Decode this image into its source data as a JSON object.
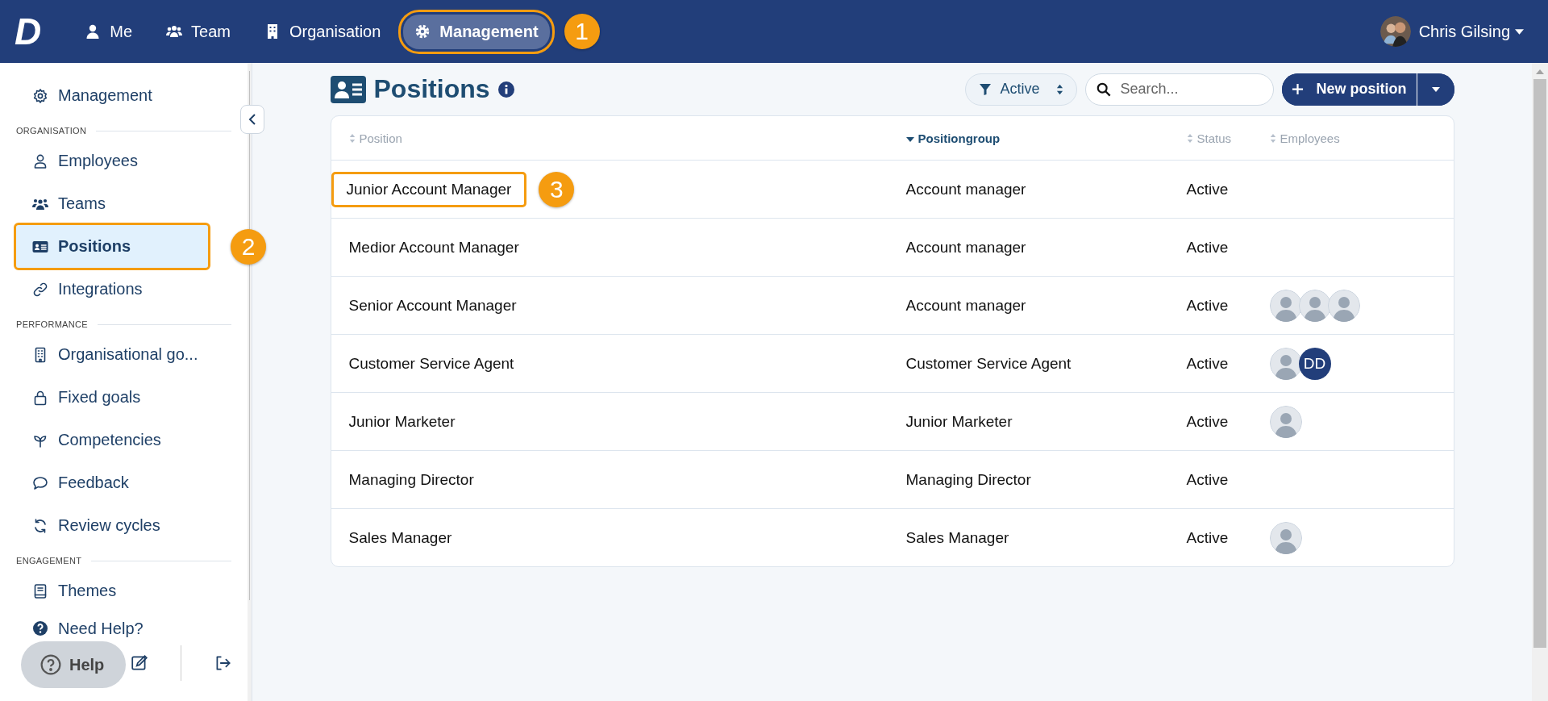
{
  "topbar": {
    "logo": "D",
    "nav": [
      {
        "label": "Me",
        "selected": false
      },
      {
        "label": "Team",
        "selected": false
      },
      {
        "label": "Organisation",
        "selected": false
      },
      {
        "label": "Management",
        "selected": true,
        "callout": "1"
      }
    ],
    "user": {
      "name": "Chris Gilsing"
    }
  },
  "sidebar": {
    "sections": [
      {
        "items": [
          {
            "label": "Management",
            "selected": false
          }
        ]
      },
      {
        "heading": "ORGANISATION",
        "items": [
          {
            "label": "Employees",
            "selected": false
          },
          {
            "label": "Teams",
            "selected": false
          },
          {
            "label": "Positions",
            "selected": true,
            "callout": "2"
          },
          {
            "label": "Integrations",
            "selected": false
          }
        ]
      },
      {
        "heading": "PERFORMANCE",
        "items": [
          {
            "label": "Organisational go...",
            "selected": false
          },
          {
            "label": "Fixed goals",
            "selected": false
          },
          {
            "label": "Competencies",
            "selected": false
          },
          {
            "label": "Feedback",
            "selected": false
          },
          {
            "label": "Review cycles",
            "selected": false
          }
        ]
      },
      {
        "heading": "ENGAGEMENT",
        "items": [
          {
            "label": "Themes",
            "selected": false
          }
        ]
      }
    ],
    "help_link": "Need Help?",
    "help_button": "Help"
  },
  "page": {
    "title": "Positions",
    "filter": "Active",
    "search": {
      "placeholder": "Search..."
    },
    "new_button": "New position"
  },
  "table": {
    "columns": [
      {
        "label": "Position",
        "sorted": false
      },
      {
        "label": "Positiongroup",
        "sorted": true
      },
      {
        "label": "Status",
        "sorted": false
      },
      {
        "label": "Employees",
        "sorted": false
      }
    ],
    "rows": [
      {
        "position": "Junior Account Manager",
        "group": "Account manager",
        "status": "Active",
        "employees": [],
        "callout": "3"
      },
      {
        "position": "Medior Account Manager",
        "group": "Account manager",
        "status": "Active",
        "employees": []
      },
      {
        "position": "Senior Account Manager",
        "group": "Account manager",
        "status": "Active",
        "employees": [
          {
            "kind": "photo"
          },
          {
            "kind": "photo"
          },
          {
            "kind": "photo"
          }
        ]
      },
      {
        "position": "Customer Service Agent",
        "group": "Customer Service Agent",
        "status": "Active",
        "employees": [
          {
            "kind": "photo"
          },
          {
            "kind": "initials",
            "initials": "DD"
          }
        ]
      },
      {
        "position": "Junior Marketer",
        "group": "Junior Marketer",
        "status": "Active",
        "employees": [
          {
            "kind": "photo"
          }
        ]
      },
      {
        "position": "Managing Director",
        "group": "Managing Director",
        "status": "Active",
        "employees": []
      },
      {
        "position": "Sales Manager",
        "group": "Sales Manager",
        "status": "Active",
        "employees": [
          {
            "kind": "photo"
          }
        ]
      }
    ]
  }
}
